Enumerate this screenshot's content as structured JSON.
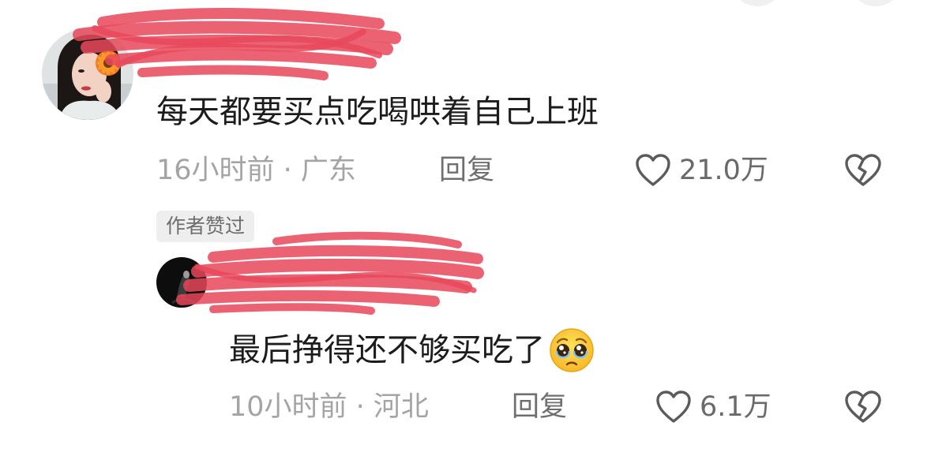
{
  "comments": [
    {
      "text": "每天都要买点吃喝哄着自己上班",
      "time_location": "16小时前 · 广东",
      "reply_label": "回复",
      "like_count": "21.0万",
      "badge": "作者赞过"
    },
    {
      "text": "最后挣得还不够买吃了",
      "emoji": "pleading-face-emoji",
      "time_location": "10小时前 · 河北",
      "reply_label": "回复",
      "like_count": "6.1万"
    }
  ],
  "colors": {
    "text": "#1c1c1c",
    "meta": "#a4a4a4",
    "redaction": "#e8485a"
  },
  "icons": {
    "like": "heart-outline-icon",
    "dislike": "broken-heart-icon"
  }
}
